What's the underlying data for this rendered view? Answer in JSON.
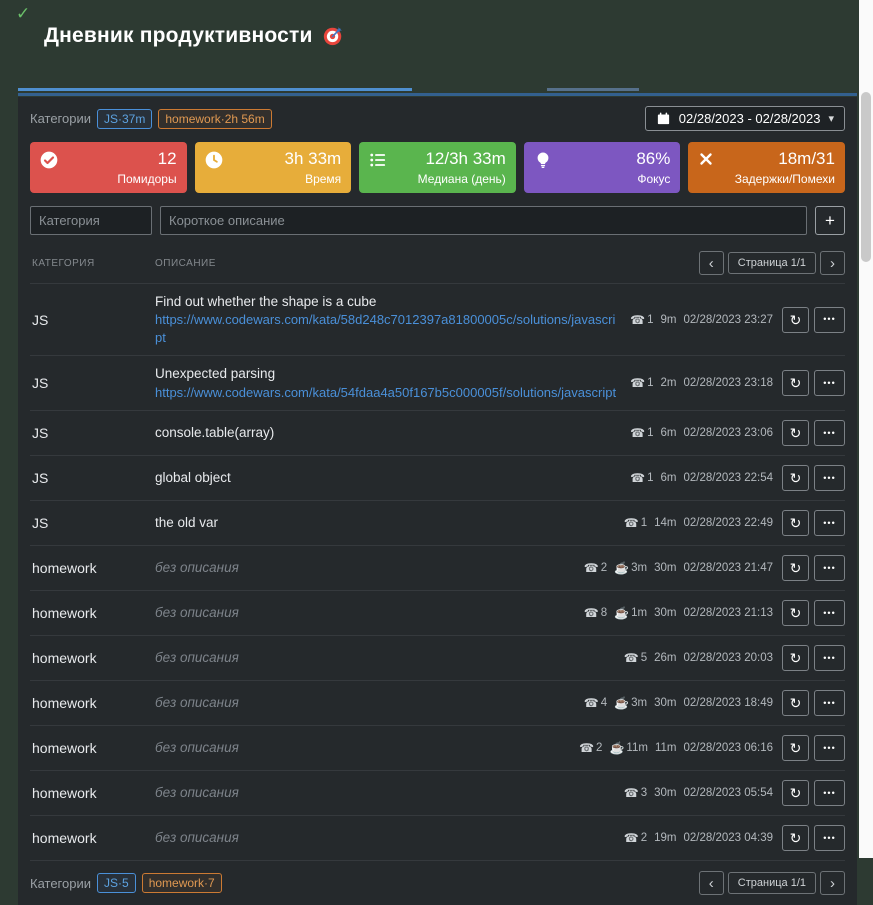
{
  "header": {
    "checkmark": "✓",
    "title": "Дневник продуктивности"
  },
  "toolbar": {
    "categories_label": "Категории",
    "badges": [
      {
        "label": "JS·37m",
        "type": "js"
      },
      {
        "label": "homework·2h 56m",
        "type": "homework"
      }
    ],
    "date_range": "02/28/2023 - 02/28/2023"
  },
  "stats": [
    {
      "icon": "check-icon",
      "value": "12",
      "label": "Помидоры",
      "color": "#dc524d"
    },
    {
      "icon": "clock-icon",
      "value": "3h 33m",
      "label": "Время",
      "color": "#e7ad3a"
    },
    {
      "icon": "list-icon",
      "value": "12/3h 33m",
      "label": "Медиана (день)",
      "color": "#5ab54e"
    },
    {
      "icon": "bulb-icon",
      "value": "86%",
      "label": "Фокус",
      "color": "#7d57c1"
    },
    {
      "icon": "x-icon",
      "value": "18m/31",
      "label": "Задержки/Помехи",
      "color": "#c8661b"
    }
  ],
  "form": {
    "category_placeholder": "Категория",
    "description_placeholder": "Короткое описание"
  },
  "table": {
    "col_category": "КАТЕГОРИЯ",
    "col_description": "ОПИСАНИЕ",
    "empty_description": "без описания",
    "rows": [
      {
        "category": "JS",
        "description": "Find out whether the shape is a cube",
        "link": "https://www.codewars.com/kata/58d248c7012397a81800005c/solutions/javascript",
        "pomodoros": "1",
        "break": "",
        "duration": "9m",
        "datetime": "02/28/2023 23:27"
      },
      {
        "category": "JS",
        "description": "Unexpected parsing",
        "link": "https://www.codewars.com/kata/54fdaa4a50f167b5c000005f/solutions/javascript",
        "pomodoros": "1",
        "break": "",
        "duration": "2m",
        "datetime": "02/28/2023 23:18"
      },
      {
        "category": "JS",
        "description": "console.table(array)",
        "link": "",
        "pomodoros": "1",
        "break": "",
        "duration": "6m",
        "datetime": "02/28/2023 23:06"
      },
      {
        "category": "JS",
        "description": "global object",
        "link": "",
        "pomodoros": "1",
        "break": "",
        "duration": "6m",
        "datetime": "02/28/2023 22:54"
      },
      {
        "category": "JS",
        "description": "the old var",
        "link": "",
        "pomodoros": "1",
        "break": "",
        "duration": "14m",
        "datetime": "02/28/2023 22:49"
      },
      {
        "category": "homework",
        "description": "",
        "link": "",
        "pomodoros": "2",
        "break": "3m",
        "duration": "30m",
        "datetime": "02/28/2023 21:47"
      },
      {
        "category": "homework",
        "description": "",
        "link": "",
        "pomodoros": "8",
        "break": "1m",
        "duration": "30m",
        "datetime": "02/28/2023 21:13"
      },
      {
        "category": "homework",
        "description": "",
        "link": "",
        "pomodoros": "5",
        "break": "",
        "duration": "26m",
        "datetime": "02/28/2023 20:03"
      },
      {
        "category": "homework",
        "description": "",
        "link": "",
        "pomodoros": "4",
        "break": "3m",
        "duration": "30m",
        "datetime": "02/28/2023 18:49"
      },
      {
        "category": "homework",
        "description": "",
        "link": "",
        "pomodoros": "2",
        "break": "11m",
        "duration": "11m",
        "datetime": "02/28/2023 06:16"
      },
      {
        "category": "homework",
        "description": "",
        "link": "",
        "pomodoros": "3",
        "break": "",
        "duration": "30m",
        "datetime": "02/28/2023 05:54"
      },
      {
        "category": "homework",
        "description": "",
        "link": "",
        "pomodoros": "2",
        "break": "",
        "duration": "19m",
        "datetime": "02/28/2023 04:39"
      }
    ]
  },
  "pagination": {
    "prev": "‹",
    "page_label": "Страница 1/1",
    "next": "›"
  },
  "footer": {
    "categories_label": "Категории",
    "badges": [
      {
        "label": "JS·5",
        "type": "js"
      },
      {
        "label": "homework·7",
        "type": "homework"
      }
    ]
  },
  "icons": {
    "chevron_down": "▾",
    "add": "+",
    "restart": "↻",
    "menu_dots": "•••",
    "phone": "☎",
    "cup": "☕"
  },
  "colors": {
    "accent_blue": "#4a90d9",
    "accent_orange": "#cc7a33",
    "panel_bg": "#25292c",
    "page_bg": "#2d3a32"
  }
}
